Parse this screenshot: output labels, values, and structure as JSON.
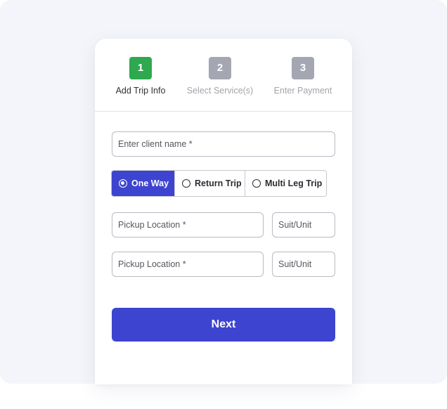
{
  "stepper": {
    "steps": [
      {
        "number": "1",
        "label": "Add Trip Info",
        "state": "active"
      },
      {
        "number": "2",
        "label": "Select Service(s)",
        "state": "inactive"
      },
      {
        "number": "3",
        "label": "Enter Payment",
        "state": "inactive"
      }
    ]
  },
  "form": {
    "client_name": {
      "value": "",
      "placeholder": "Enter client name *"
    },
    "trip_type": {
      "selected": "One Way",
      "options": [
        {
          "label": "One Way"
        },
        {
          "label": "Return Trip"
        },
        {
          "label": "Multi Leg Trip"
        }
      ]
    },
    "locations": [
      {
        "pickup": {
          "value": "",
          "placeholder": "Pickup Location *"
        },
        "unit": {
          "value": "",
          "placeholder": "Suit/Unit"
        }
      },
      {
        "pickup": {
          "value": "",
          "placeholder": "Pickup Location *"
        },
        "unit": {
          "value": "",
          "placeholder": "Suit/Unit"
        }
      }
    ],
    "next_label": "Next"
  },
  "colors": {
    "primary": "#3d44cf",
    "step_active": "#2fa84f",
    "step_inactive": "#a4a6b1",
    "backdrop": "#f4f5fa"
  }
}
